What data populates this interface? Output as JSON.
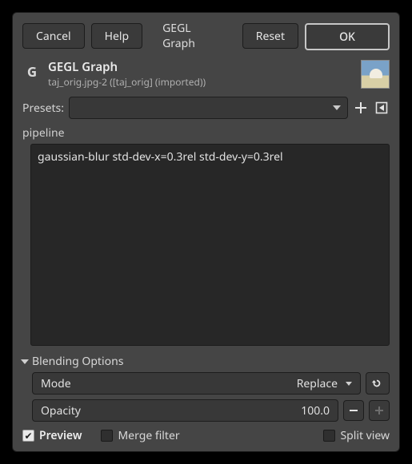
{
  "buttons": {
    "cancel": "Cancel",
    "help": "Help",
    "title": "GEGL Graph",
    "reset": "Reset",
    "ok": "OK"
  },
  "header": {
    "logo_letter": "G",
    "title": "GEGL Graph",
    "subtitle": "taj_orig.jpg-2 ([taj_orig] (imported))"
  },
  "presets": {
    "label": "Presets:",
    "value": ""
  },
  "pipeline": {
    "label": "pipeline",
    "text": "gaussian-blur std-dev-x=0.3rel std-dev-y=0.3rel"
  },
  "blending": {
    "section_label": "Blending Options",
    "mode_label": "Mode",
    "mode_value": "Replace",
    "opacity_label": "Opacity",
    "opacity_value": "100.0"
  },
  "footer": {
    "preview_label": "Preview",
    "preview_checked": true,
    "merge_label": "Merge filter",
    "merge_checked": false,
    "split_label": "Split view",
    "split_checked": false
  }
}
